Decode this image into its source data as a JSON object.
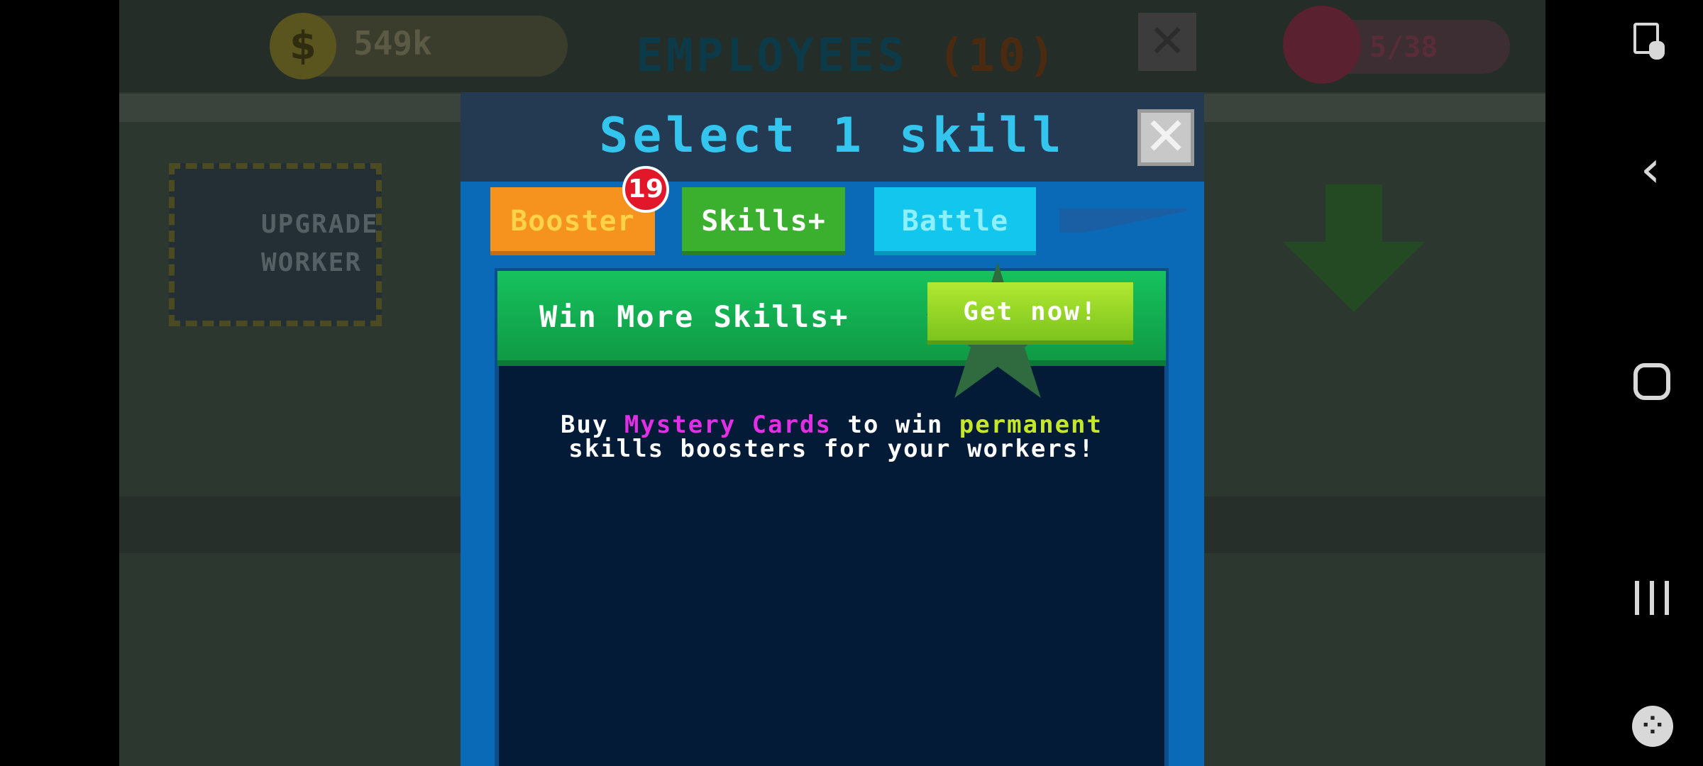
{
  "background": {
    "coins": "549k",
    "coin_symbol": "$",
    "employees_title": "EMPLOYEES",
    "employees_count": "(10)",
    "close_symbol": "✕",
    "donut_counter": "5/38",
    "upgrade_worker": "UPGRADE\nWORKER"
  },
  "dialog": {
    "title": "Select 1 skill",
    "close_symbol": "✕",
    "tabs": [
      {
        "label": "Booster",
        "badge": "19",
        "color": "#f6921e"
      },
      {
        "label": "Skills+",
        "color": "#3ab02e"
      },
      {
        "label": "Battle",
        "color": "#13c6ee"
      }
    ],
    "banner": {
      "text": "Win More Skills+",
      "button": "Get now!"
    },
    "description": {
      "part1": "Buy ",
      "highlight1": "Mystery Cards",
      "part2": " to win ",
      "highlight2": "permanent",
      "part3": "skills boosters for your workers!"
    }
  },
  "colors": {
    "dialog_blue": "#0b6ab8",
    "title_cyan": "#33c5ee",
    "highlight_magenta": "#e22fe6",
    "highlight_lime": "#c6e62a"
  },
  "system_nav": {
    "icons": [
      "shortcut-icon",
      "back-icon",
      "home-icon",
      "recents-icon",
      "game-launcher-icon"
    ]
  }
}
